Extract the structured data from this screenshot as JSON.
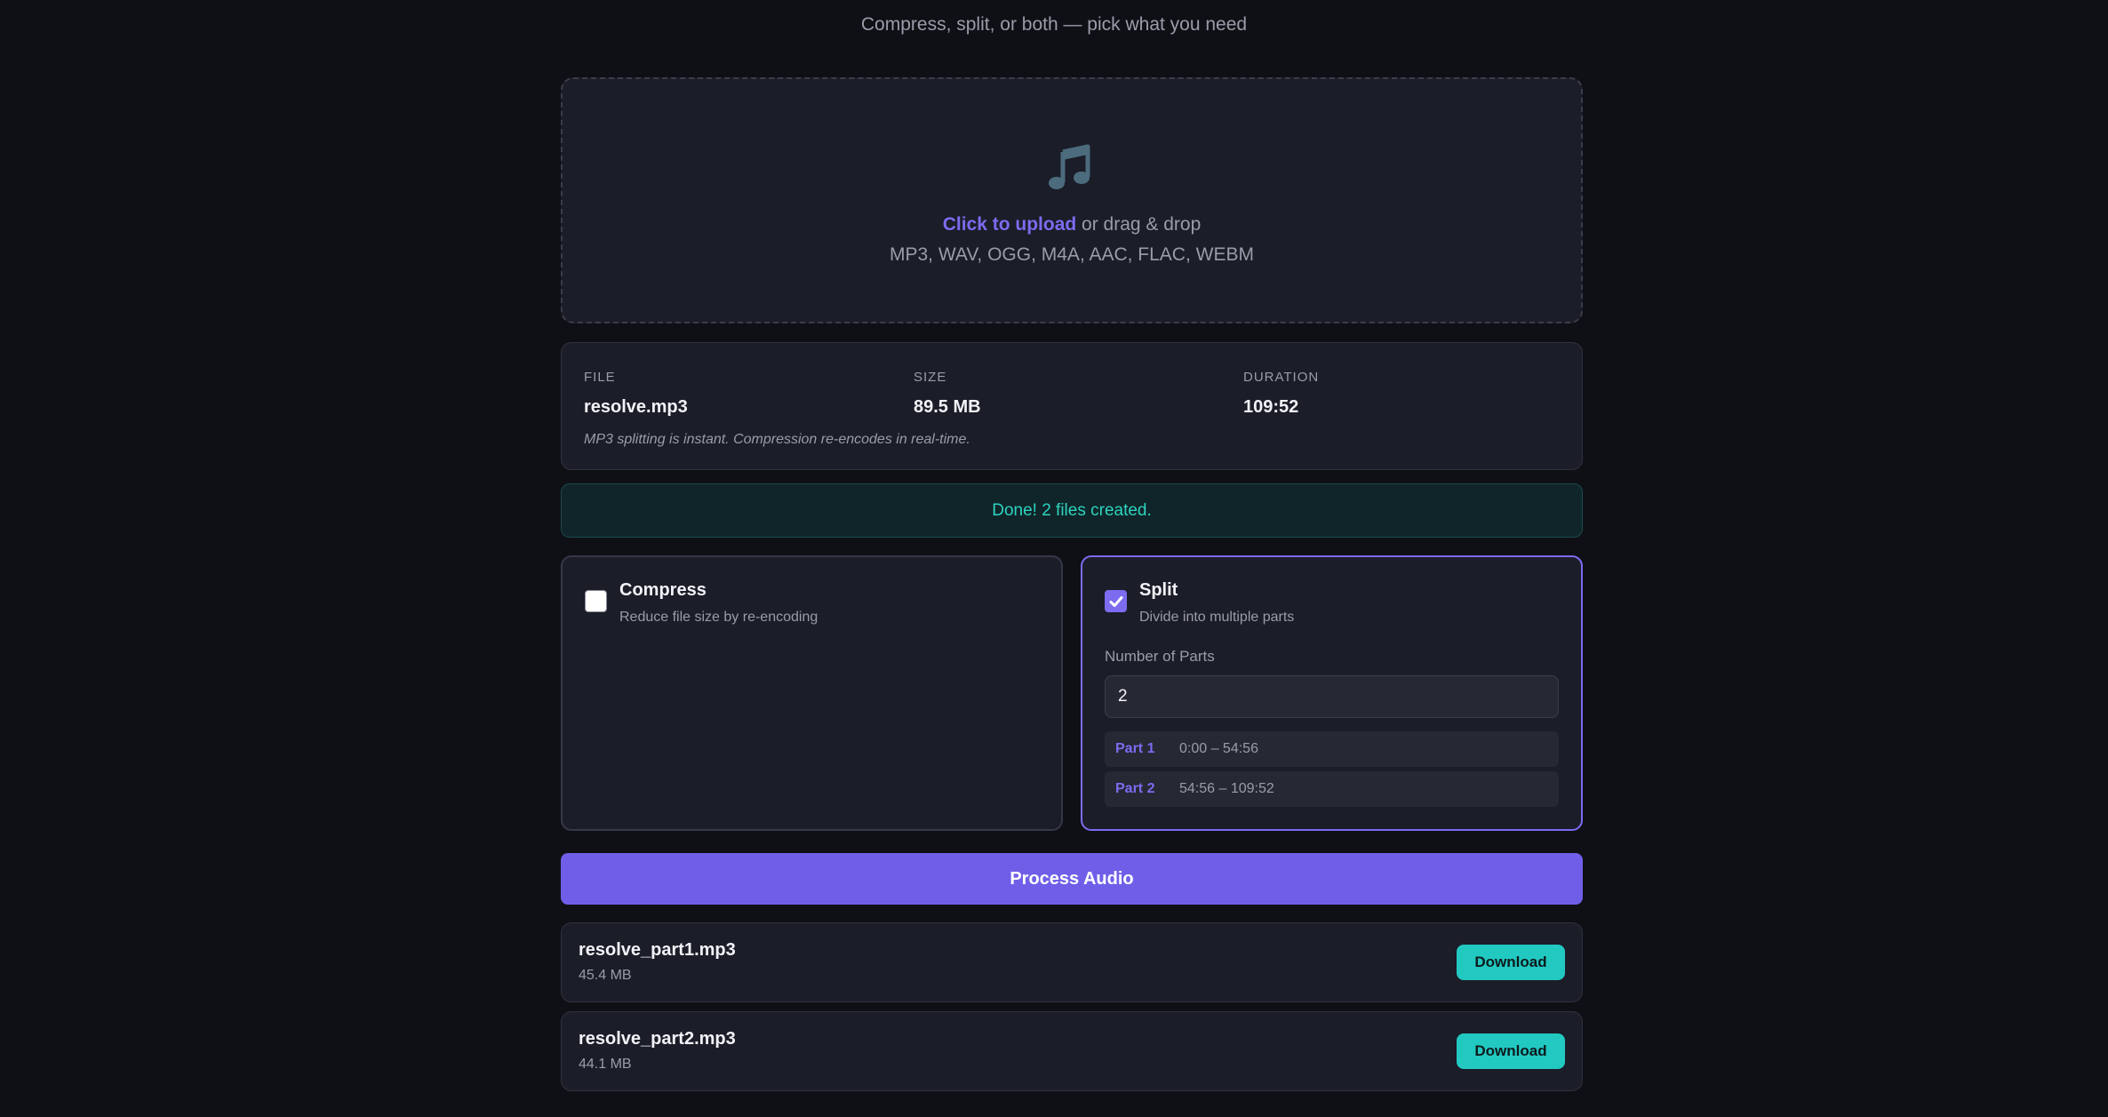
{
  "header": {
    "subtitle": "Compress, split, or both — pick what you need"
  },
  "upload": {
    "icon": "music-note-icon",
    "link_text": "Click to upload",
    "rest_text": " or drag & drop",
    "formats": "MP3, WAV, OGG, M4A, AAC, FLAC, WEBM"
  },
  "file_info": {
    "file_label": "FILE",
    "file_value": "resolve.mp3",
    "size_label": "SIZE",
    "size_value": "89.5 MB",
    "duration_label": "DURATION",
    "duration_value": "109:52",
    "hint": "MP3 splitting is instant. Compression re-encodes in real-time."
  },
  "status": {
    "message": "Done! 2 files created."
  },
  "options": {
    "compress": {
      "title": "Compress",
      "desc": "Reduce file size by re-encoding",
      "checked": false
    },
    "split": {
      "title": "Split",
      "desc": "Divide into multiple parts",
      "checked": true,
      "parts_label": "Number of Parts",
      "parts_value": "2",
      "parts": [
        {
          "name": "Part 1",
          "range": "0:00 – 54:56"
        },
        {
          "name": "Part 2",
          "range": "54:56 – 109:52"
        }
      ]
    }
  },
  "actions": {
    "process_label": "Process Audio"
  },
  "outputs": [
    {
      "name": "resolve_part1.mp3",
      "size": "45.4 MB",
      "download_label": "Download"
    },
    {
      "name": "resolve_part2.mp3",
      "size": "44.1 MB",
      "download_label": "Download"
    }
  ],
  "colors": {
    "accent": "#7b6cf0",
    "success": "#2dd4bf",
    "download": "#22c9c1"
  }
}
